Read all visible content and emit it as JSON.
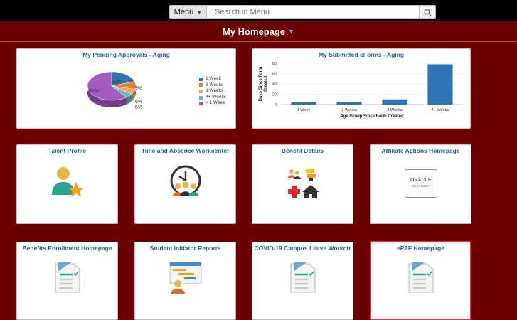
{
  "search": {
    "menu_label": "Menu",
    "placeholder": "Search in Menu"
  },
  "page": {
    "title": "My Homepage"
  },
  "tiles": {
    "pending": {
      "title": "My Pending Approvals - Aging"
    },
    "eforms": {
      "title": "My Submitted eForms - Aging"
    },
    "talent": {
      "title": "Talent Profile"
    },
    "time_absence": {
      "title": "Time and Absence Workcenter"
    },
    "benefit_details": {
      "title": "Benefit Details"
    },
    "affiliate": {
      "title": "Affiliate Actions Homepage",
      "logo_line1": "ORACLE",
      "logo_line2": "PEOPLESOFT"
    },
    "benefits_enroll": {
      "title": "Benefits Enrollment Homepage"
    },
    "student_reports": {
      "title": "Student Initiator Reports"
    },
    "covid": {
      "title": "COVID-19 Campus Leave Workctr"
    },
    "epaf": {
      "title": "ePAF Homepage"
    }
  },
  "chart_data": [
    {
      "type": "pie",
      "title": "My Pending Approvals - Aging",
      "categories": [
        "1 Week",
        "2 Weeks",
        "3 Weeks",
        "4+ Weeks",
        "< 1 Week"
      ],
      "values": [
        20,
        9,
        9,
        6,
        5
      ],
      "labels": [
        "20%",
        "9%",
        "6%",
        "5%",
        "61%"
      ],
      "slices": [
        {
          "name": "1 Week",
          "value": 20,
          "label": "20%"
        },
        {
          "name": "2 Weeks",
          "value": 9,
          "label": "9%"
        },
        {
          "name": "3 Weeks",
          "value": 6,
          "label": "6%"
        },
        {
          "name": "4+ Weeks",
          "value": 5,
          "label": "5%"
        },
        {
          "name": "< 1 Week",
          "value": 61,
          "label": "61%"
        }
      ],
      "colors": [
        "#2e75b6",
        "#ed7d31",
        "#f0a868",
        "#5fb8c9",
        "#a35bc1"
      ],
      "legend": "right"
    },
    {
      "type": "bar",
      "title": "My Submitted eForms - Aging",
      "categories": [
        "1 Week",
        "2 Weeks",
        "3 Weeks",
        "4+ Weeks"
      ],
      "values": [
        5,
        5,
        10,
        78
      ],
      "xlabel": "Age Group Since Form Created",
      "ylabel": "Days Since Form Created",
      "ylim": [
        0,
        80
      ],
      "yticks": [
        "0",
        "20",
        "40",
        "60",
        "80"
      ],
      "color": "#2e75b6",
      "grid": true
    }
  ],
  "colors": {
    "background": "#6b0000",
    "link": "#2b5ea7",
    "selected_border": "#e2343f"
  }
}
